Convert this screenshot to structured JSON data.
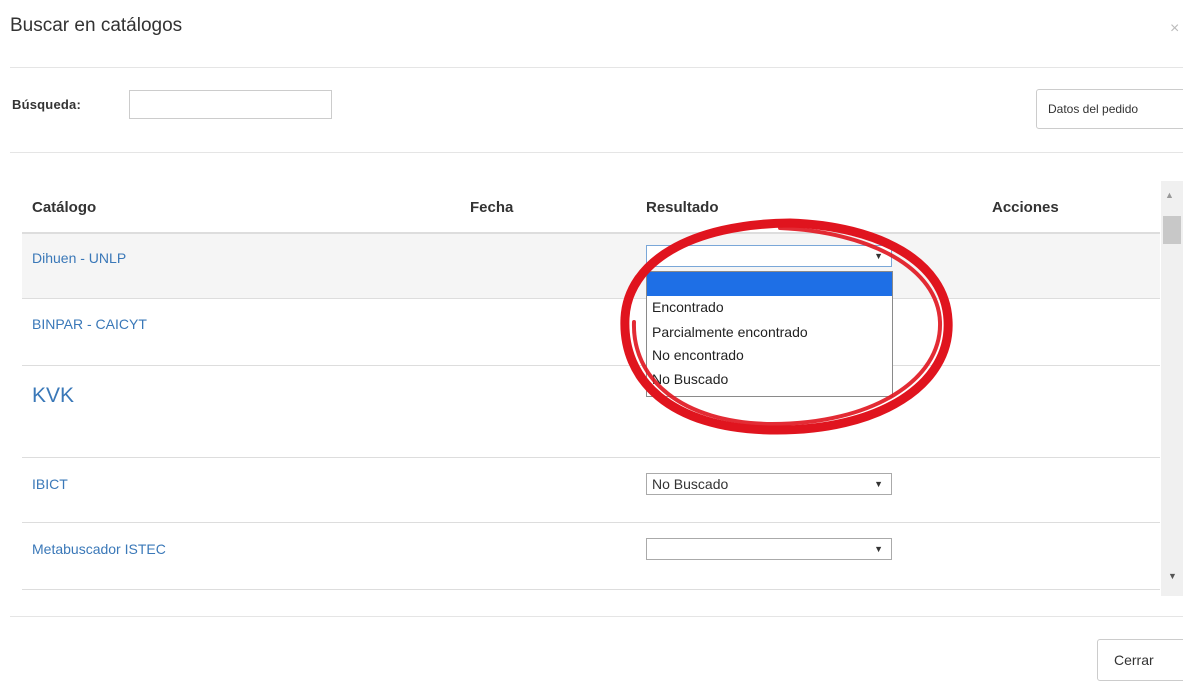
{
  "modal": {
    "title": "Buscar en catálogos",
    "close_glyph": "×"
  },
  "search": {
    "label": "Búsqueda:",
    "value": "",
    "placeholder": ""
  },
  "buttons": {
    "datos_pedido": "Datos del pedido",
    "cerrar": "Cerrar"
  },
  "table": {
    "headers": {
      "catalogo": "Catálogo",
      "fecha": "Fecha",
      "resultado": "Resultado",
      "acciones": "Acciones"
    },
    "rows": [
      {
        "catalogo": "Dihuen - UNLP",
        "fecha": "",
        "resultado": "",
        "acciones": ""
      },
      {
        "catalogo": "BINPAR - CAICYT",
        "fecha": "",
        "resultado": "",
        "acciones": ""
      },
      {
        "catalogo": "KVK",
        "fecha": "",
        "resultado": "",
        "acciones": ""
      },
      {
        "catalogo": "IBICT",
        "fecha": "",
        "resultado": "No Buscado",
        "acciones": ""
      },
      {
        "catalogo": "Metabuscador ISTEC",
        "fecha": "",
        "resultado": "",
        "acciones": ""
      }
    ]
  },
  "dropdown": {
    "open_on_row": 0,
    "options": [
      "",
      "Encontrado",
      "Parcialmente encontrado",
      "No encontrado",
      "No Buscado"
    ],
    "highlighted_index": 0
  },
  "colors": {
    "link": "#3a78b8",
    "highlight": "#1e6fe6",
    "annotation": "#e0141e",
    "row_stripe": "#f5f5f5"
  },
  "icons": {
    "select_arrow": "▼",
    "scroll_up": "▲",
    "scroll_down": "▼"
  }
}
